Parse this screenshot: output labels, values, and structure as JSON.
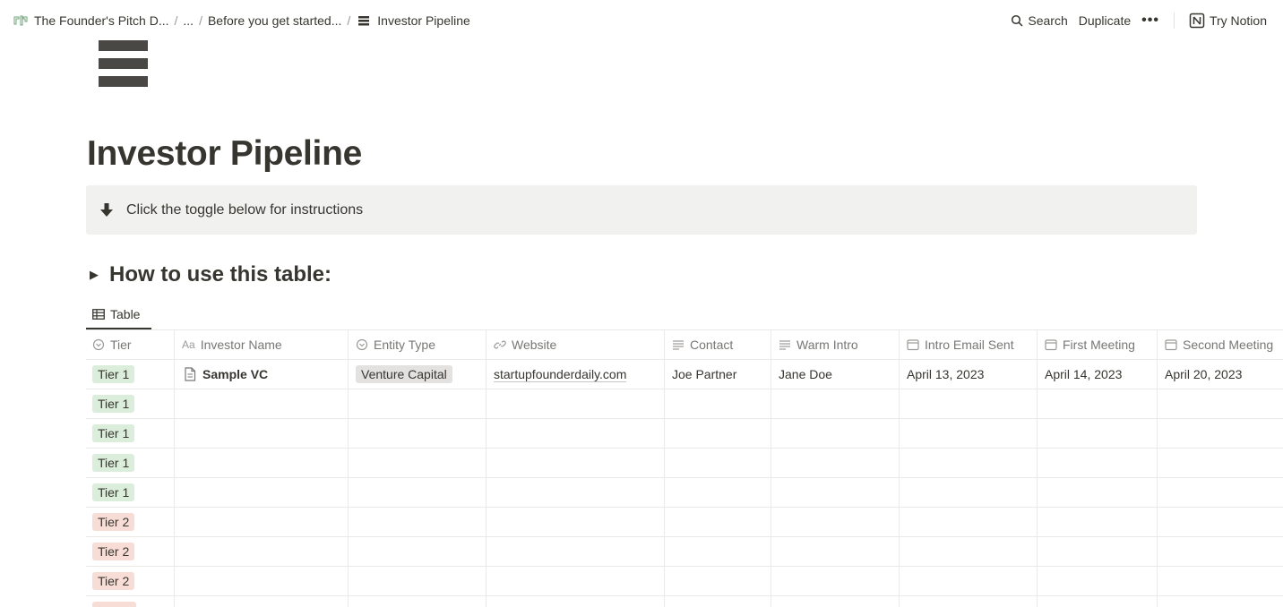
{
  "breadcrumb": {
    "items": [
      "The Founder's Pitch D...",
      "...",
      "Before you get started...",
      "Investor Pipeline"
    ],
    "separator": "/"
  },
  "topbar": {
    "search_label": "Search",
    "duplicate_label": "Duplicate",
    "more_label": "•••",
    "try_label": "Try Notion"
  },
  "page": {
    "title": "Investor Pipeline",
    "callout_text": "Click the toggle below for instructions",
    "toggle_heading": "How to use this table:"
  },
  "view": {
    "tab_label": "Table"
  },
  "table": {
    "columns": [
      {
        "label": "Tier",
        "icon": "select-icon"
      },
      {
        "label": "Investor Name",
        "icon": "text-aa-icon"
      },
      {
        "label": "Entity Type",
        "icon": "select-icon"
      },
      {
        "label": "Website",
        "icon": "link-icon"
      },
      {
        "label": "Contact",
        "icon": "lines-icon"
      },
      {
        "label": "Warm Intro",
        "icon": "lines-icon"
      },
      {
        "label": "Intro Email Sent",
        "icon": "calendar-icon"
      },
      {
        "label": "First Meeting",
        "icon": "calendar-icon"
      },
      {
        "label": "Second Meeting",
        "icon": "calendar-icon"
      }
    ],
    "text_icon_glyph": "Aa",
    "first_row": {
      "tier": "Tier 1",
      "name": "Sample VC",
      "entity": "Venture Capital",
      "website": "startupfounderdaily.com",
      "contact": "Joe Partner",
      "warm_intro": "Jane Doe",
      "intro_email": "April 13, 2023",
      "first_meeting": "April 14, 2023",
      "second_meeting": "April 20, 2023"
    },
    "tiers": [
      "Tier 1",
      "Tier 1",
      "Tier 1",
      "Tier 1",
      "Tier 2",
      "Tier 2",
      "Tier 2"
    ]
  },
  "colors": {
    "tier1_bg": "#dbeddb",
    "tier2_bg": "#f8ddd6",
    "entity_bg": "#e3e2e0",
    "callout_bg": "#f1f1ef",
    "text": "#37352f"
  }
}
